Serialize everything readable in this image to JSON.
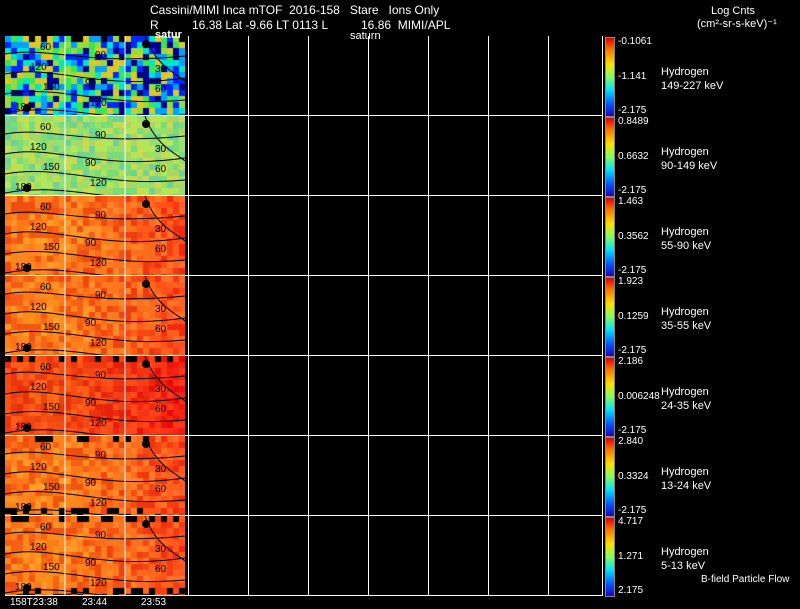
{
  "header": {
    "title": "Cassini/MIMI Inca mTOF  2016-158   Stare   Ions Only",
    "line2": "R          16.38 Lat -9.66 LT 0113 L          16.86  MIMI/APL",
    "panel_label_left": "satur",
    "panel_label_mid": "saturn",
    "units_title": "Log Cnts",
    "units_sub": "(cm²-sr-s-keV)⁻¹"
  },
  "rows": [
    {
      "species": "Hydrogen",
      "energy": "149-227 keV",
      "max": "-0.1061",
      "mid": "-1.141",
      "min": "-2.175",
      "tone": "noise"
    },
    {
      "species": "Hydrogen",
      "energy": "90-149 keV",
      "max": "0.8489",
      "mid": "0.6632",
      "min": "-2.175",
      "tone": "green"
    },
    {
      "species": "Hydrogen",
      "energy": "55-90 keV",
      "max": "1.463",
      "mid": "0.3562",
      "min": "-2.175",
      "tone": "orange"
    },
    {
      "species": "Hydrogen",
      "energy": "35-55 keV",
      "max": "1.923",
      "mid": "0.1259",
      "min": "-2.175",
      "tone": "orange"
    },
    {
      "species": "Hydrogen",
      "energy": "24-35 keV",
      "max": "2.186",
      "mid": "0.006248",
      "min": "-2.175",
      "tone": "red"
    },
    {
      "species": "Hydrogen",
      "energy": "13-24 keV",
      "max": "2.840",
      "mid": "0.3324",
      "min": "-2.175",
      "tone": "orange"
    },
    {
      "species": "Hydrogen",
      "energy": "5-13 keV",
      "max": "4.717",
      "mid": "1.271",
      "min": "2.175",
      "tone": "orange"
    }
  ],
  "contour_labels": [
    "30",
    "60",
    "90",
    "120",
    "150",
    "180"
  ],
  "footer": {
    "bfield": "B-field Particle Flow",
    "times": [
      "158T23:38",
      "23:44",
      "23:53"
    ]
  }
}
